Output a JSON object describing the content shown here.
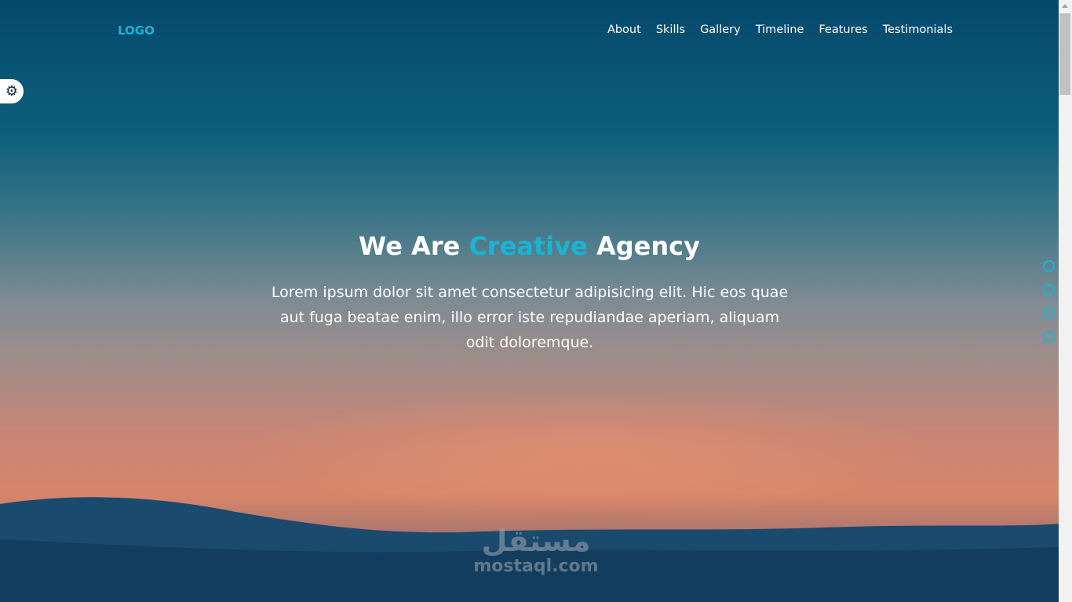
{
  "header": {
    "logo": "LOGO",
    "nav": [
      "About",
      "Skills",
      "Gallery",
      "Timeline",
      "Features",
      "Testimonials"
    ]
  },
  "settings": {
    "icon": "gear-icon"
  },
  "hero": {
    "title_pre": "We Are",
    "title_accent": "Creative",
    "title_post": "Agency",
    "description": "Lorem ipsum dolor sit amet consectetur adipisicing elit. Hic eos quae aut fuga beatae enim, illo error iste repudiandae aperiam, aliquam odit doloremque."
  },
  "bullets_count": 4,
  "watermark": {
    "arabic": "مستقل",
    "latin": "mostaql.com"
  },
  "colors": {
    "accent": "#19b4d6"
  }
}
